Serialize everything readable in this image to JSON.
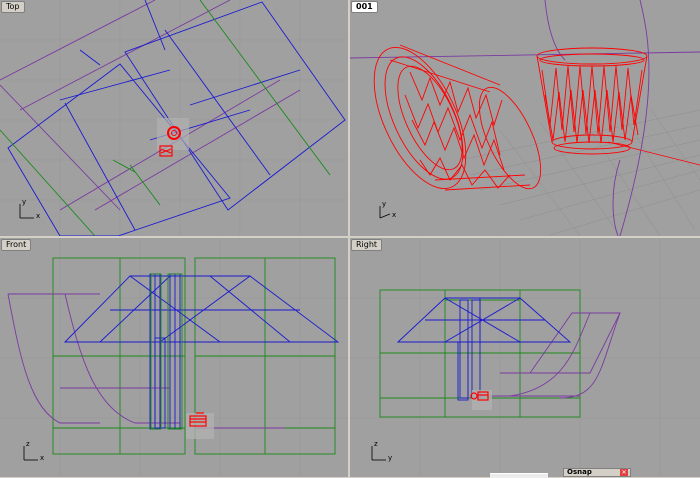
{
  "viewports": {
    "top": {
      "title": "Top",
      "axis_x": "x",
      "axis_y": "y",
      "active": false
    },
    "perspective": {
      "title": "001",
      "axis_x": "x",
      "axis_y": "y",
      "active": true
    },
    "front": {
      "title": "Front",
      "axis_x": "x",
      "axis_y": "z",
      "active": false
    },
    "right": {
      "title": "Right",
      "axis_x": "y",
      "axis_y": "z",
      "active": false
    }
  },
  "osnap": {
    "label": "Osnap",
    "close_glyph": "✕",
    "close_icon": "close-icon"
  },
  "colors": {
    "viewport_bg": "#a0a0a0",
    "grid": "#8c8c8c",
    "blue_lines": "#1a1ad0",
    "green_lines": "#1a8a1a",
    "purple_lines": "#7a3aa0",
    "selected_red": "#ff0000"
  }
}
